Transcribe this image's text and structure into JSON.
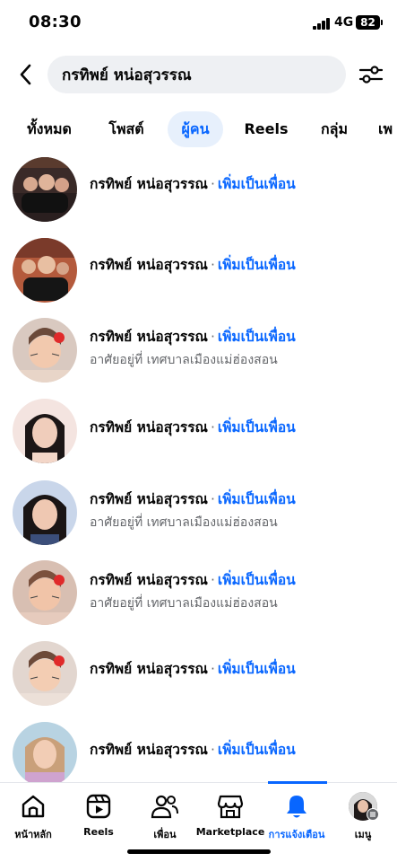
{
  "status_bar": {
    "time": "08:30",
    "network": "4G",
    "battery": "82"
  },
  "search": {
    "query": "กรทิพย์ หน่อสุวรรณ"
  },
  "tabs": [
    {
      "label": "ทั้งหมด"
    },
    {
      "label": "โพสต์"
    },
    {
      "label": "ผู้คน",
      "active": true
    },
    {
      "label": "Reels"
    },
    {
      "label": "กลุ่ม"
    },
    {
      "label": "เพ"
    }
  ],
  "results": [
    {
      "name": "กรทิพย์ หน่อสุวรรณ",
      "separator": "·",
      "action": "เพิ่มเป็นเพื่อน",
      "subtitle": ""
    },
    {
      "name": "กรทิพย์ หน่อสุวรรณ",
      "separator": "·",
      "action": "เพิ่มเป็นเพื่อน",
      "subtitle": ""
    },
    {
      "name": "กรทิพย์ หน่อสุวรรณ",
      "separator": "·",
      "action": "เพิ่มเป็นเพื่อน",
      "subtitle": "อาศัยอยู่ที่ เทศบาลเมืองแม่ฮ่องสอน"
    },
    {
      "name": "กรทิพย์ หน่อสุวรรณ",
      "separator": "·",
      "action": "เพิ่มเป็นเพื่อน",
      "subtitle": ""
    },
    {
      "name": "กรทิพย์ หน่อสุวรรณ",
      "separator": "·",
      "action": "เพิ่มเป็นเพื่อน",
      "subtitle": "อาศัยอยู่ที่ เทศบาลเมืองแม่ฮ่องสอน"
    },
    {
      "name": "กรทิพย์ หน่อสุวรรณ",
      "separator": "·",
      "action": "เพิ่มเป็นเพื่อน",
      "subtitle": "อาศัยอยู่ที่ เทศบาลเมืองแม่ฮ่องสอน"
    },
    {
      "name": "กรทิพย์ หน่อสุวรรณ",
      "separator": "·",
      "action": "เพิ่มเป็นเพื่อน",
      "subtitle": ""
    },
    {
      "name": "กรทิพย์ หน่อสุวรรณ",
      "separator": "·",
      "action": "เพิ่มเป็นเพื่อน",
      "subtitle": ""
    }
  ],
  "bottom_nav": [
    {
      "label": "หน้าหลัก",
      "icon": "home-icon"
    },
    {
      "label": "Reels",
      "icon": "reels-icon"
    },
    {
      "label": "เพื่อน",
      "icon": "friends-icon"
    },
    {
      "label": "Marketplace",
      "icon": "marketplace-icon"
    },
    {
      "label": "การแจ้งเตือน",
      "icon": "bell-icon",
      "active": true
    },
    {
      "label": "เมนู",
      "icon": "menu-avatar"
    }
  ],
  "colors": {
    "accent": "#0866ff",
    "secondary_text": "#65676b",
    "search_bg": "#eef0f3",
    "active_tab_bg": "#e7f0fc"
  }
}
